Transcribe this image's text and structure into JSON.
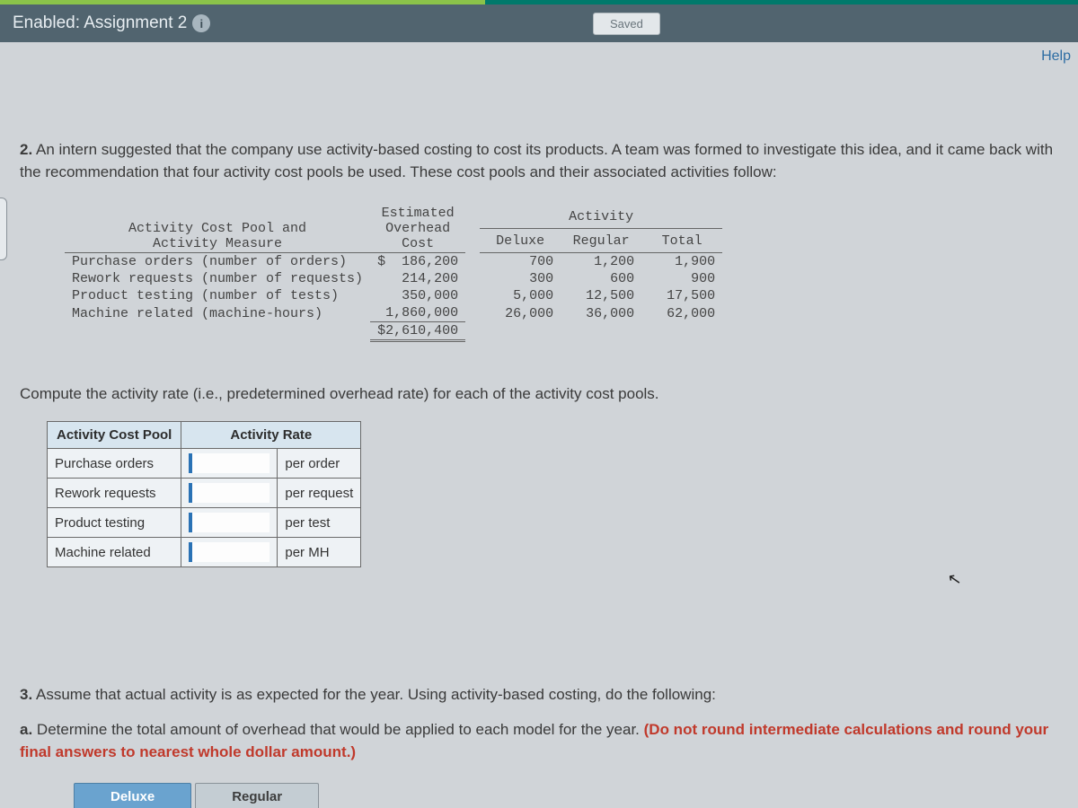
{
  "header": {
    "title": "Enabled: Assignment 2",
    "saved_label": "Saved",
    "help_label": "Help"
  },
  "question2": {
    "number": "2.",
    "text": "An intern suggested that the company use activity-based costing to cost its products. A team was formed to investigate this idea, and it came back with the recommendation that four activity cost pools be used. These cost pools and their associated activities follow:"
  },
  "cost_table": {
    "headers": {
      "pool": "Activity Cost Pool and Activity Measure",
      "cost": "Estimated Overhead Cost",
      "activity": "Activity",
      "deluxe": "Deluxe",
      "regular": "Regular",
      "total": "Total"
    },
    "currency": "$",
    "rows": [
      {
        "pool": "Purchase orders (number of orders)",
        "cost": "186,200",
        "deluxe": "700",
        "regular": "1,200",
        "total": "1,900"
      },
      {
        "pool": "Rework requests (number of requests)",
        "cost": "214,200",
        "deluxe": "300",
        "regular": "600",
        "total": "900"
      },
      {
        "pool": "Product testing (number of tests)",
        "cost": "350,000",
        "deluxe": "5,000",
        "regular": "12,500",
        "total": "17,500"
      },
      {
        "pool": "Machine related (machine-hours)",
        "cost": "1,860,000",
        "deluxe": "26,000",
        "regular": "36,000",
        "total": "62,000"
      }
    ],
    "total_cost": "$2,610,400"
  },
  "instruction": "Compute the activity rate (i.e., predetermined overhead rate) for each of the activity cost pools.",
  "rate_table": {
    "headers": {
      "pool": "Activity Cost Pool",
      "rate": "Activity Rate"
    },
    "rows": [
      {
        "pool": "Purchase orders",
        "unit": "per order"
      },
      {
        "pool": "Rework requests",
        "unit": "per request"
      },
      {
        "pool": "Product testing",
        "unit": "per test"
      },
      {
        "pool": "Machine related",
        "unit": "per MH"
      }
    ]
  },
  "question3": {
    "number": "3.",
    "intro": "Assume that actual activity is as expected for the year. Using activity-based costing, do the following:",
    "part_a_label": "a.",
    "part_a_text": "Determine the total amount of overhead that would be applied to each model for the year.",
    "note_red": "(Do not round intermediate calculations and round your final answers to nearest whole dollar amount.)"
  },
  "tabs": {
    "deluxe": "Deluxe",
    "regular": "Regular"
  }
}
